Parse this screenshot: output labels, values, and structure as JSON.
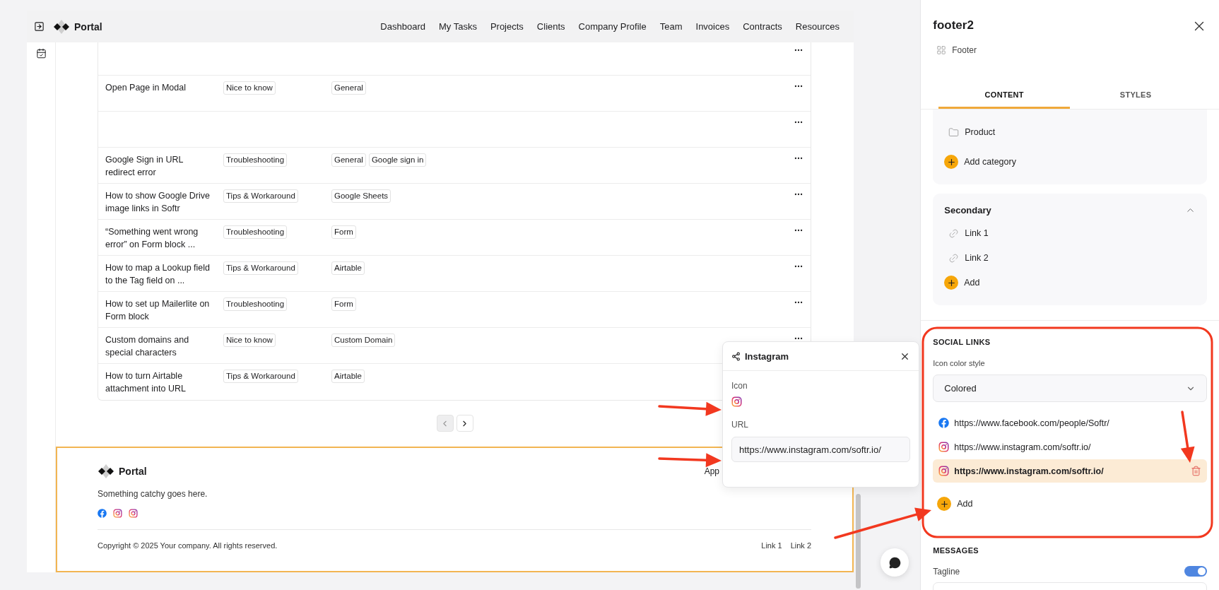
{
  "nav": {
    "brand": "Portal",
    "links": [
      "Dashboard",
      "My Tasks",
      "Projects",
      "Clients",
      "Company Profile",
      "Team",
      "Invoices",
      "Contracts",
      "Resources"
    ]
  },
  "table": {
    "rows": [
      {
        "kind": "empty"
      },
      {
        "kind": "entry",
        "title": "Open Page in Modal",
        "category": "Nice to know",
        "tags": [
          "General"
        ]
      },
      {
        "kind": "empty"
      },
      {
        "kind": "entry",
        "title": "Google Sign in URL redirect error",
        "category": "Troubleshooting",
        "tags": [
          "General",
          "Google sign in"
        ]
      },
      {
        "kind": "entry",
        "title": "How to show Google Drive image links in Softr",
        "category": "Tips & Workaround",
        "tags": [
          "Google Sheets"
        ]
      },
      {
        "kind": "entry",
        "title": "“Something went wrong error” on Form block ...",
        "category": "Troubleshooting",
        "tags": [
          "Form"
        ]
      },
      {
        "kind": "entry",
        "title": "How to map a Lookup field to the Tag field on ...",
        "category": "Tips & Workaround",
        "tags": [
          "Airtable"
        ]
      },
      {
        "kind": "entry",
        "title": "How to set up Mailerlite on Form block",
        "category": "Troubleshooting",
        "tags": [
          "Form"
        ]
      },
      {
        "kind": "entry",
        "title": "Custom domains and special characters",
        "category": "Nice to know",
        "tags": [
          "Custom Domain"
        ]
      },
      {
        "kind": "covered",
        "title": "How to turn Airtable attachment into URL",
        "category": "Tips & Workaround",
        "tags": [
          "Airtable"
        ]
      }
    ]
  },
  "pagination": {
    "previous": {
      "disabled": true
    },
    "next": {
      "disabled": false
    }
  },
  "footer_block": {
    "brand": "Portal",
    "cut_text": "App",
    "tagline": "Something catchy goes here.",
    "social_icons": [
      {
        "kind": "facebook"
      },
      {
        "kind": "instagram"
      },
      {
        "kind": "instagram"
      }
    ],
    "copyright": "Copyright © 2025 Your company. All rights reserved.",
    "links": [
      "Link 1",
      "Link 2"
    ]
  },
  "popup": {
    "title": "Instagram",
    "icon_label": "Icon",
    "icon": {
      "kind": "instagram"
    },
    "url_label": "URL",
    "url": "https://www.instagram.com/softr.io/"
  },
  "panel": {
    "title": "footer2",
    "subtitle": "Footer",
    "tabs": [
      {
        "label": "CONTENT",
        "selected": true
      },
      {
        "label": "STYLES",
        "selected": false
      }
    ],
    "categories": {
      "items": [
        "Product"
      ],
      "add_label": "Add category"
    },
    "secondary": {
      "title": "Secondary",
      "expanded": true,
      "links": [
        "Link 1",
        "Link 2"
      ],
      "add_label": "Add"
    },
    "social_links": {
      "heading": "SOCIAL LINKS",
      "style_label": "Icon color style",
      "style_value": "Colored",
      "links": [
        {
          "kind": "facebook",
          "url": "https://www.facebook.com/people/Softr/",
          "selected": false
        },
        {
          "kind": "instagram",
          "url": "https://www.instagram.com/softr.io/",
          "selected": false
        },
        {
          "kind": "instagram",
          "url": "https://www.instagram.com/softr.io/",
          "selected": true
        }
      ],
      "add_label": "Add"
    },
    "messages": {
      "heading": "MESSAGES",
      "tagline_label": "Tagline",
      "tagline_on": true
    }
  }
}
